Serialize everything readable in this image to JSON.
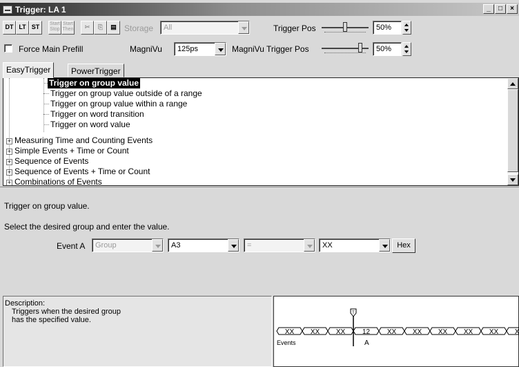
{
  "window": {
    "title": "Trigger: LA 1",
    "min": "_",
    "max": "□",
    "close": "×"
  },
  "toolbar": {
    "buttons": [
      {
        "label": "DT",
        "name": "d-trigger"
      },
      {
        "label": "LT",
        "name": "l-trigger"
      },
      {
        "label": "ST",
        "name": "s-trigger"
      }
    ],
    "dim_buttons": [
      {
        "label": "Start Stop",
        "name": "start-stop"
      },
      {
        "label": "Start Then",
        "name": "start-then"
      }
    ],
    "storage_label": "Storage",
    "storage_value": "All",
    "trigger_pos_label": "Trigger Pos",
    "trigger_pos_value": "50%",
    "trigger_pos_fraction": 0.5
  },
  "row2": {
    "force_prefill_label": "Force Main Prefill",
    "force_prefill_checked": false,
    "magnivu_label": "MagniVu",
    "magnivu_value": "125ps",
    "magnivu_trigger_pos_label": "MagniVu Trigger Pos",
    "magnivu_trigger_pos_value": "50%",
    "magnivu_trigger_pos_fraction": 0.85
  },
  "tabs": [
    {
      "label": "EasyTrigger",
      "active": true
    },
    {
      "label": "PowerTrigger",
      "active": false
    }
  ],
  "tree": {
    "children": [
      "Trigger on group value",
      "Trigger on group value outside of a range",
      "Trigger on group value within a range",
      "Trigger on word transition",
      "Trigger on word value"
    ],
    "categories": [
      "Measuring Time and Counting Events",
      "Simple Events + Time or Count",
      "Sequence of Events",
      "Sequence of Events + Time or Count",
      "Combinations of Events"
    ],
    "selected": 0
  },
  "editor": {
    "heading": "Trigger on group value.",
    "instruction": "Select the desired group and enter the value.",
    "event_label": "Event A",
    "type_value": "Group",
    "group_value": "A3",
    "op_value": "=",
    "value_value": "XX",
    "radix_button": "Hex"
  },
  "description": {
    "label": "Description:",
    "text1": "Triggers when the desired group",
    "text2": "has the specified value."
  },
  "waveform": {
    "segments": [
      "XX",
      "XX",
      "XX",
      "12",
      "XX",
      "XX",
      "XX",
      "XX",
      "XX",
      "XX"
    ],
    "events_label": "Events",
    "marker_label": "A",
    "trigger_marker": "T"
  },
  "colors": {
    "selection": "#000000",
    "window_bg": "#d9d9d9",
    "titlebar": "#2b2b2b"
  }
}
